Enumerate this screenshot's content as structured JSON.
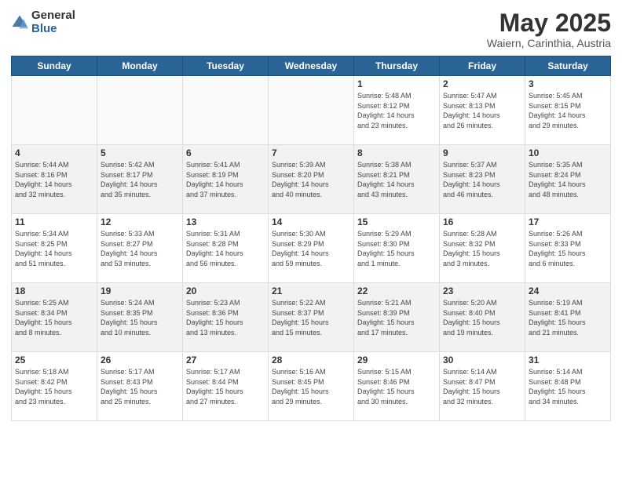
{
  "logo": {
    "general": "General",
    "blue": "Blue"
  },
  "title": {
    "month": "May 2025",
    "location": "Waiern, Carinthia, Austria"
  },
  "headers": [
    "Sunday",
    "Monday",
    "Tuesday",
    "Wednesday",
    "Thursday",
    "Friday",
    "Saturday"
  ],
  "weeks": [
    [
      {
        "day": "",
        "info": ""
      },
      {
        "day": "",
        "info": ""
      },
      {
        "day": "",
        "info": ""
      },
      {
        "day": "",
        "info": ""
      },
      {
        "day": "1",
        "info": "Sunrise: 5:48 AM\nSunset: 8:12 PM\nDaylight: 14 hours\nand 23 minutes."
      },
      {
        "day": "2",
        "info": "Sunrise: 5:47 AM\nSunset: 8:13 PM\nDaylight: 14 hours\nand 26 minutes."
      },
      {
        "day": "3",
        "info": "Sunrise: 5:45 AM\nSunset: 8:15 PM\nDaylight: 14 hours\nand 29 minutes."
      }
    ],
    [
      {
        "day": "4",
        "info": "Sunrise: 5:44 AM\nSunset: 8:16 PM\nDaylight: 14 hours\nand 32 minutes."
      },
      {
        "day": "5",
        "info": "Sunrise: 5:42 AM\nSunset: 8:17 PM\nDaylight: 14 hours\nand 35 minutes."
      },
      {
        "day": "6",
        "info": "Sunrise: 5:41 AM\nSunset: 8:19 PM\nDaylight: 14 hours\nand 37 minutes."
      },
      {
        "day": "7",
        "info": "Sunrise: 5:39 AM\nSunset: 8:20 PM\nDaylight: 14 hours\nand 40 minutes."
      },
      {
        "day": "8",
        "info": "Sunrise: 5:38 AM\nSunset: 8:21 PM\nDaylight: 14 hours\nand 43 minutes."
      },
      {
        "day": "9",
        "info": "Sunrise: 5:37 AM\nSunset: 8:23 PM\nDaylight: 14 hours\nand 46 minutes."
      },
      {
        "day": "10",
        "info": "Sunrise: 5:35 AM\nSunset: 8:24 PM\nDaylight: 14 hours\nand 48 minutes."
      }
    ],
    [
      {
        "day": "11",
        "info": "Sunrise: 5:34 AM\nSunset: 8:25 PM\nDaylight: 14 hours\nand 51 minutes."
      },
      {
        "day": "12",
        "info": "Sunrise: 5:33 AM\nSunset: 8:27 PM\nDaylight: 14 hours\nand 53 minutes."
      },
      {
        "day": "13",
        "info": "Sunrise: 5:31 AM\nSunset: 8:28 PM\nDaylight: 14 hours\nand 56 minutes."
      },
      {
        "day": "14",
        "info": "Sunrise: 5:30 AM\nSunset: 8:29 PM\nDaylight: 14 hours\nand 59 minutes."
      },
      {
        "day": "15",
        "info": "Sunrise: 5:29 AM\nSunset: 8:30 PM\nDaylight: 15 hours\nand 1 minute."
      },
      {
        "day": "16",
        "info": "Sunrise: 5:28 AM\nSunset: 8:32 PM\nDaylight: 15 hours\nand 3 minutes."
      },
      {
        "day": "17",
        "info": "Sunrise: 5:26 AM\nSunset: 8:33 PM\nDaylight: 15 hours\nand 6 minutes."
      }
    ],
    [
      {
        "day": "18",
        "info": "Sunrise: 5:25 AM\nSunset: 8:34 PM\nDaylight: 15 hours\nand 8 minutes."
      },
      {
        "day": "19",
        "info": "Sunrise: 5:24 AM\nSunset: 8:35 PM\nDaylight: 15 hours\nand 10 minutes."
      },
      {
        "day": "20",
        "info": "Sunrise: 5:23 AM\nSunset: 8:36 PM\nDaylight: 15 hours\nand 13 minutes."
      },
      {
        "day": "21",
        "info": "Sunrise: 5:22 AM\nSunset: 8:37 PM\nDaylight: 15 hours\nand 15 minutes."
      },
      {
        "day": "22",
        "info": "Sunrise: 5:21 AM\nSunset: 8:39 PM\nDaylight: 15 hours\nand 17 minutes."
      },
      {
        "day": "23",
        "info": "Sunrise: 5:20 AM\nSunset: 8:40 PM\nDaylight: 15 hours\nand 19 minutes."
      },
      {
        "day": "24",
        "info": "Sunrise: 5:19 AM\nSunset: 8:41 PM\nDaylight: 15 hours\nand 21 minutes."
      }
    ],
    [
      {
        "day": "25",
        "info": "Sunrise: 5:18 AM\nSunset: 8:42 PM\nDaylight: 15 hours\nand 23 minutes."
      },
      {
        "day": "26",
        "info": "Sunrise: 5:17 AM\nSunset: 8:43 PM\nDaylight: 15 hours\nand 25 minutes."
      },
      {
        "day": "27",
        "info": "Sunrise: 5:17 AM\nSunset: 8:44 PM\nDaylight: 15 hours\nand 27 minutes."
      },
      {
        "day": "28",
        "info": "Sunrise: 5:16 AM\nSunset: 8:45 PM\nDaylight: 15 hours\nand 29 minutes."
      },
      {
        "day": "29",
        "info": "Sunrise: 5:15 AM\nSunset: 8:46 PM\nDaylight: 15 hours\nand 30 minutes."
      },
      {
        "day": "30",
        "info": "Sunrise: 5:14 AM\nSunset: 8:47 PM\nDaylight: 15 hours\nand 32 minutes."
      },
      {
        "day": "31",
        "info": "Sunrise: 5:14 AM\nSunset: 8:48 PM\nDaylight: 15 hours\nand 34 minutes."
      }
    ]
  ]
}
